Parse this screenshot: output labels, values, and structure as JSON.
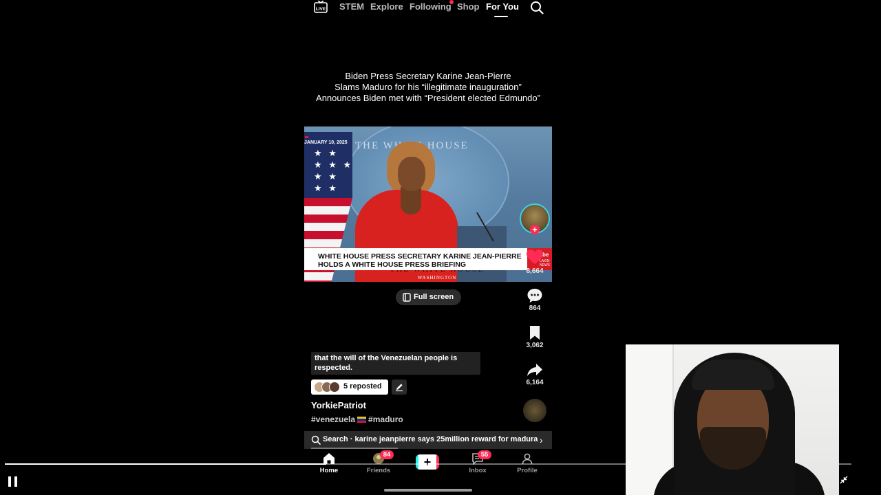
{
  "top_nav": {
    "live_icon": "live-icon",
    "tabs": [
      {
        "label": "STEM"
      },
      {
        "label": "Explore"
      },
      {
        "label": "Following"
      },
      {
        "label": "Shop"
      },
      {
        "label": "For You"
      }
    ],
    "active_tab": "For You",
    "search_icon": "search-icon"
  },
  "post": {
    "headline_lines": [
      "Biden Press Secretary Karine Jean-Pierre",
      "Slams Maduro for his “illegitimate inauguration”",
      "Announces Biden met with “President elected Edmundo”"
    ],
    "video": {
      "date_tag": "JANUARY 10, 2025",
      "backdrop_text": "THE WHITE HOUSE",
      "podium_text": "THE WHITE HOUSE",
      "podium_sub": "WASHINGTON",
      "chyron_line1": "WHITE HOUSE PRESS SECRETARY KARINE JEAN-PIERRE",
      "chyron_line2": "HOLDS A WHITE HOUSE PRESS BRIEFING",
      "chyron_logo": "be",
      "chyron_logo_sub": "LAKIN NEWS"
    },
    "fullscreen_label": "Full screen",
    "caption": "that the will of the Venezuelan people is respected.",
    "reposted_label": "5 reposted",
    "username": "YorkiePatriot",
    "hashtag_1": "#venezuela",
    "hashtag_2": "#maduro",
    "search_prompt": "Search · karine jeanpierre says 25million reward for madura"
  },
  "actions": {
    "likes": "8,664",
    "comments": "864",
    "saves": "3,062",
    "shares": "6,164"
  },
  "bottom_nav": {
    "items": [
      {
        "label": "Home",
        "icon": "home-icon"
      },
      {
        "label": "Friends",
        "icon": "friends-icon",
        "badge": "84"
      },
      {
        "label": "",
        "icon": "create-icon"
      },
      {
        "label": "Inbox",
        "icon": "inbox-icon",
        "badge": "55"
      },
      {
        "label": "Profile",
        "icon": "profile-icon"
      }
    ],
    "create_glyph": "+"
  },
  "player": {
    "progress": 0.38,
    "pause_icon": "pause-icon",
    "collapse_icon": "collapse-icon"
  },
  "colors": {
    "accent_pink": "#fe2c55",
    "accent_cyan": "#25f4ee",
    "background": "#000000"
  }
}
